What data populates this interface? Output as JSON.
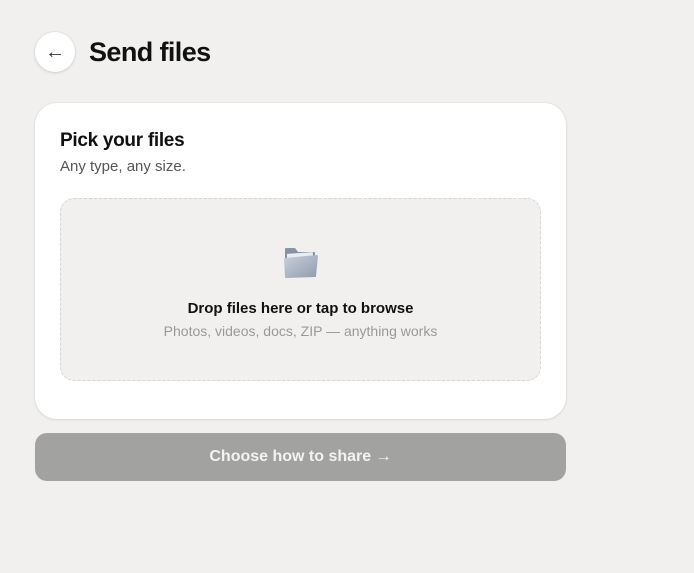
{
  "header": {
    "back_icon": "←",
    "title": "Send files"
  },
  "card": {
    "title": "Pick your files",
    "subtitle": "Any type, any size."
  },
  "dropzone": {
    "icon": "folder-icon",
    "title": "Drop files here or tap to browse",
    "hint": "Photos, videos, docs, ZIP — anything works"
  },
  "share_button": {
    "label": "Choose how to share →",
    "state": "disabled"
  },
  "colors": {
    "background": "#f1f0ee",
    "card": "#ffffff",
    "button_disabled": "#a2a2a0"
  }
}
